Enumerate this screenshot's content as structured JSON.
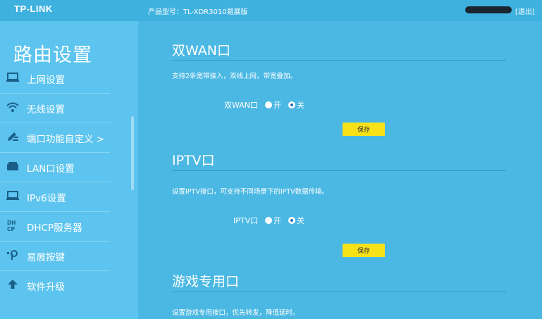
{
  "header": {
    "logo": "TP-LINK",
    "model": "产品型号：TL-XDR3010易展版",
    "logout": "[退出]"
  },
  "sidebar": {
    "title": "路由设置",
    "items": [
      {
        "label": "上网设置",
        "icon": "laptop-icon"
      },
      {
        "label": "无线设置",
        "icon": "wifi-icon"
      },
      {
        "label": "端口功能自定义 >",
        "icon": "pencil-icon",
        "active": true
      },
      {
        "label": "LAN口设置",
        "icon": "router-icon"
      },
      {
        "label": "IPv6设置",
        "icon": "laptop-icon"
      },
      {
        "label": "DHCP服务器",
        "icon": "dhcp-icon"
      },
      {
        "label": "易展按键",
        "icon": "key-icon"
      },
      {
        "label": "软件升级",
        "icon": "upload-arrow-icon"
      }
    ]
  },
  "sections": {
    "dual_wan": {
      "title": "双WAN口",
      "desc": "支持2条宽带接入，双线上网，带宽叠加。",
      "field": "双WAN口",
      "on": "开",
      "off": "关",
      "selected": "off",
      "save": "保存"
    },
    "iptv": {
      "title": "IPTV口",
      "desc": "设置IPTV接口，可支持不同场景下的IPTV数据传输。",
      "field": "IPTV口",
      "on": "开",
      "off": "关",
      "selected": "off",
      "save": "保存"
    },
    "game": {
      "title": "游戏专用口",
      "desc": "设置游戏专用接口，优先转发，降低延时。"
    }
  },
  "colors": {
    "sidebar_bg": "#5cc4ee",
    "main_bg": "#4bb8e3",
    "save_button": "#f7e21a"
  }
}
